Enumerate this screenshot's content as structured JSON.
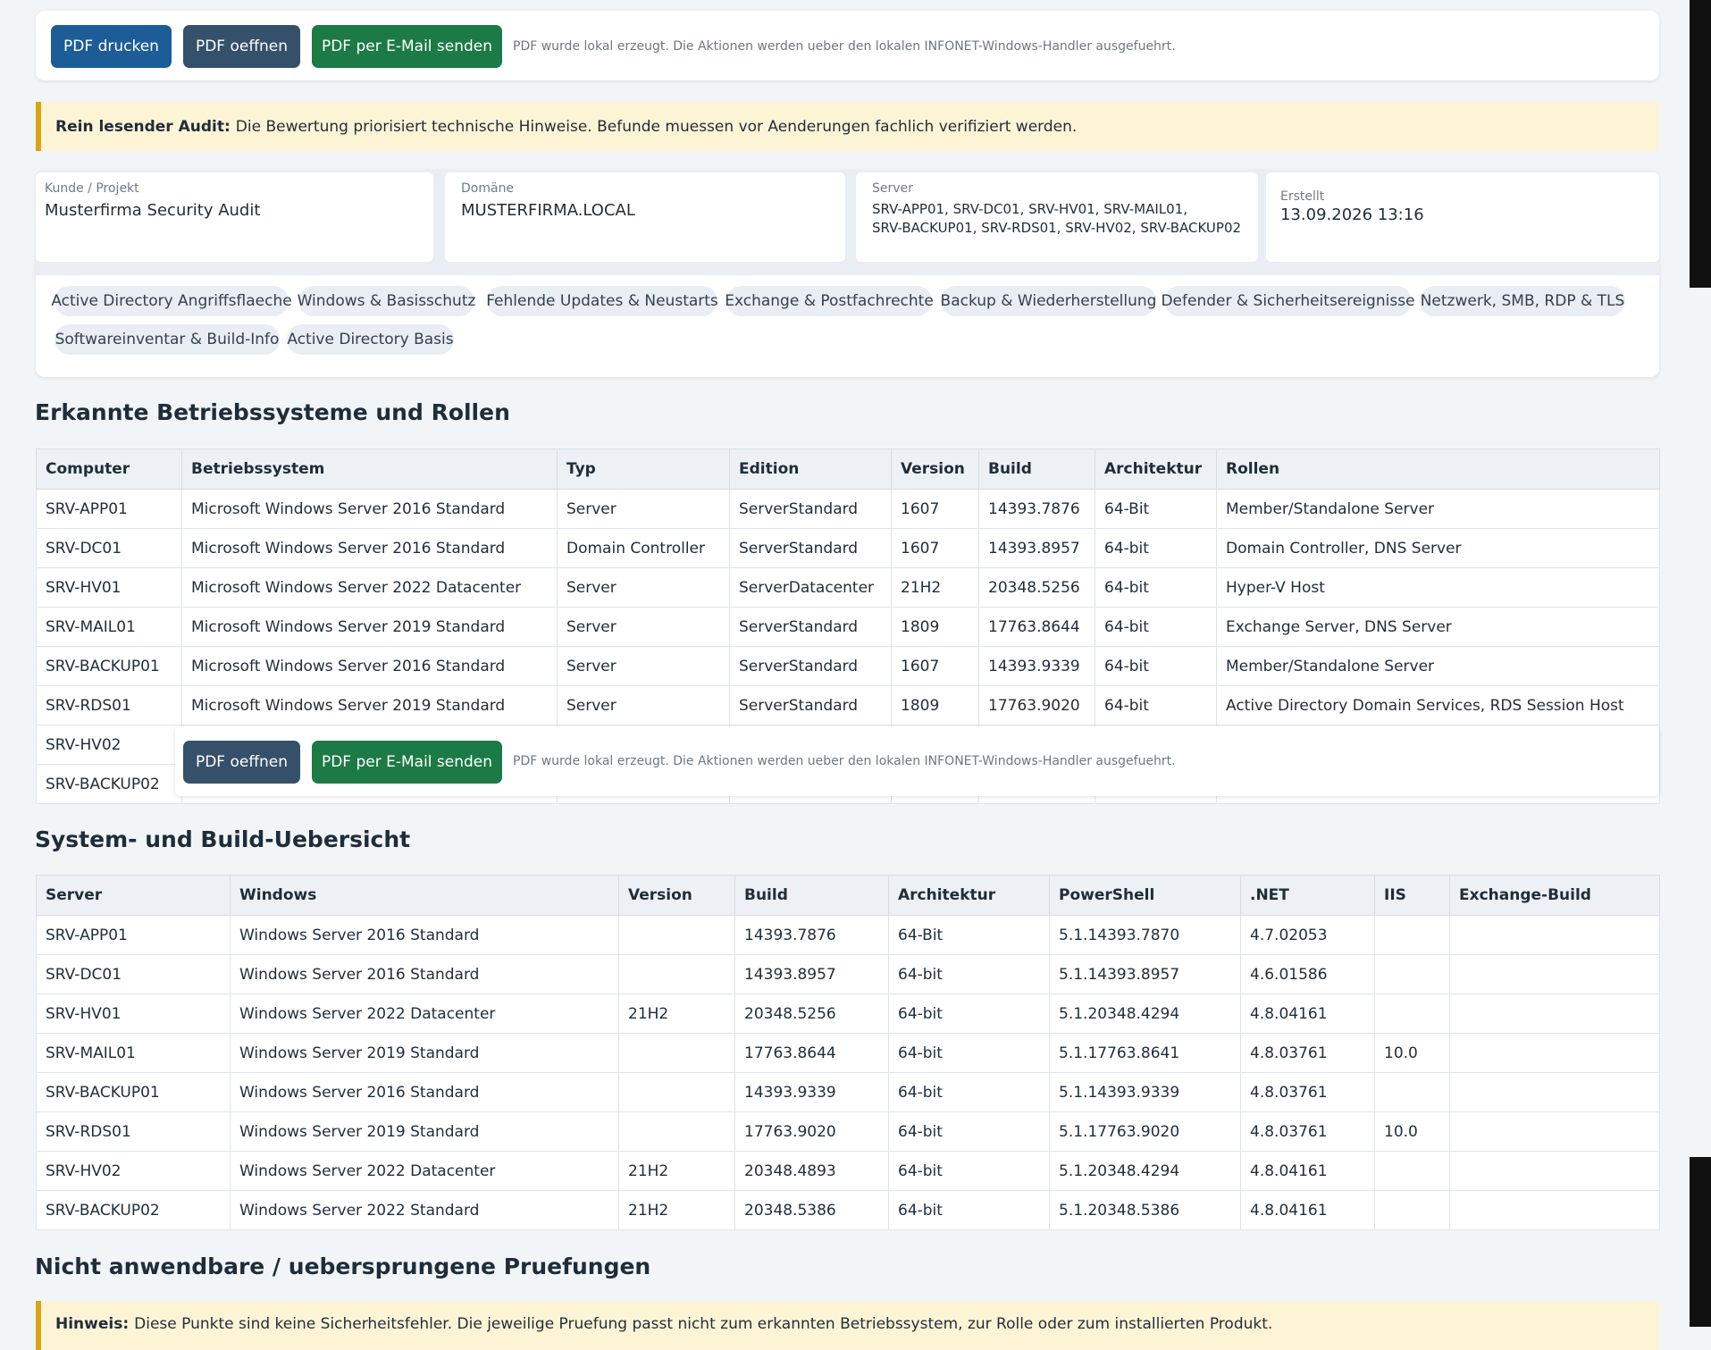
{
  "toolbar": {
    "print_label": "PDF drucken",
    "open_label": "PDF oeffnen",
    "email_label": "PDF per E-Mail senden",
    "note": "PDF wurde lokal erzeugt. Die Aktionen werden ueber den lokalen INFONET-Windows-Handler ausgefuehrt."
  },
  "audit_notice": {
    "bold": "Rein lesender Audit:",
    "text": "Die Bewertung priorisiert technische Hinweise. Befunde muessen vor Aenderungen fachlich verifiziert werden."
  },
  "meta": {
    "customer_label": "Kunde / Projekt",
    "customer_value": "Musterfirma Security Audit",
    "domain_label": "Domäne",
    "domain_value": "MUSTERFIRMA.LOCAL",
    "server_label": "Server",
    "server_value_line1": "SRV-APP01, SRV-DC01, SRV-HV01, SRV-MAIL01,",
    "server_value_line2": "SRV-BACKUP01, SRV-RDS01, SRV-HV02, SRV-BACKUP02",
    "created_label": "Erstellt",
    "created_value": "13.09.2026 13:16"
  },
  "chips": [
    "Active Directory Angriffsflaeche",
    "Windows & Basisschutz",
    "Fehlende Updates & Neustarts",
    "Exchange & Postfachrechte",
    "Backup & Wiederherstellung",
    "Defender & Sicherheitsereignisse",
    "Netzwerk, SMB, RDP & TLS",
    "Softwareinventar & Build-Info",
    "Active Directory Basis"
  ],
  "section1": {
    "title": "Erkannte Betriebssysteme und Rollen",
    "headers": [
      "Computer",
      "Betriebssystem",
      "Typ",
      "Edition",
      "Version",
      "Build",
      "Architektur",
      "Rollen"
    ],
    "rows": [
      [
        "SRV-APP01",
        "Microsoft Windows Server 2016 Standard",
        "Server",
        "ServerStandard",
        "1607",
        "14393.7876",
        "64-Bit",
        "Member/Standalone Server"
      ],
      [
        "SRV-DC01",
        "Microsoft Windows Server 2016 Standard",
        "Domain Controller",
        "ServerStandard",
        "1607",
        "14393.8957",
        "64-bit",
        "Domain Controller, DNS Server"
      ],
      [
        "SRV-HV01",
        "Microsoft Windows Server 2022 Datacenter",
        "Server",
        "ServerDatacenter",
        "21H2",
        "20348.5256",
        "64-bit",
        "Hyper-V Host"
      ],
      [
        "SRV-MAIL01",
        "Microsoft Windows Server 2019 Standard",
        "Server",
        "ServerStandard",
        "1809",
        "17763.8644",
        "64-bit",
        "Exchange Server, DNS Server"
      ],
      [
        "SRV-BACKUP01",
        "Microsoft Windows Server 2016 Standard",
        "Server",
        "ServerStandard",
        "1607",
        "14393.9339",
        "64-bit",
        "Member/Standalone Server"
      ],
      [
        "SRV-RDS01",
        "Microsoft Windows Server 2019 Standard",
        "Server",
        "ServerStandard",
        "1809",
        "17763.9020",
        "64-bit",
        "Active Directory Domain Services, RDS Session Host"
      ],
      [
        "SRV-HV02",
        "",
        "",
        "",
        "",
        "",
        "",
        ""
      ],
      [
        "SRV-BACKUP02",
        "",
        "",
        "",
        "",
        "",
        "",
        ""
      ]
    ]
  },
  "section2": {
    "title": "System- und Build-Uebersicht",
    "headers": [
      "Server",
      "Windows",
      "Version",
      "Build",
      "Architektur",
      "PowerShell",
      ".NET",
      "IIS",
      "Exchange-Build"
    ],
    "rows": [
      [
        "SRV-APP01",
        "Windows Server 2016 Standard",
        "",
        "14393.7876",
        "64-Bit",
        "5.1.14393.7870",
        "4.7.02053",
        "",
        ""
      ],
      [
        "SRV-DC01",
        "Windows Server 2016 Standard",
        "",
        "14393.8957",
        "64-bit",
        "5.1.14393.8957",
        "4.6.01586",
        "",
        ""
      ],
      [
        "SRV-HV01",
        "Windows Server 2022 Datacenter",
        "21H2",
        "20348.5256",
        "64-bit",
        "5.1.20348.4294",
        "4.8.04161",
        "",
        ""
      ],
      [
        "SRV-MAIL01",
        "Windows Server 2019 Standard",
        "",
        "17763.8644",
        "64-bit",
        "5.1.17763.8641",
        "4.8.03761",
        "10.0",
        ""
      ],
      [
        "SRV-BACKUP01",
        "Windows Server 2016 Standard",
        "",
        "14393.9339",
        "64-bit",
        "5.1.14393.9339",
        "4.8.03761",
        "",
        ""
      ],
      [
        "SRV-RDS01",
        "Windows Server 2019 Standard",
        "",
        "17763.9020",
        "64-bit",
        "5.1.17763.9020",
        "4.8.03761",
        "10.0",
        ""
      ],
      [
        "SRV-HV02",
        "Windows Server 2022 Datacenter",
        "21H2",
        "20348.4893",
        "64-bit",
        "5.1.20348.4294",
        "4.8.04161",
        "",
        ""
      ],
      [
        "SRV-BACKUP02",
        "Windows Server 2022 Standard",
        "21H2",
        "20348.5386",
        "64-bit",
        "5.1.20348.5386",
        "4.8.04161",
        "",
        ""
      ]
    ]
  },
  "section3": {
    "title": "Nicht anwendbare / uebersprungene Pruefungen",
    "hint_bold": "Hinweis:",
    "hint_text": "Diese Punkte sind keine Sicherheitsfehler. Die jeweilige Pruefung passt nicht zum erkannten Betriebssystem, zur Rolle oder zum installierten Produkt."
  }
}
